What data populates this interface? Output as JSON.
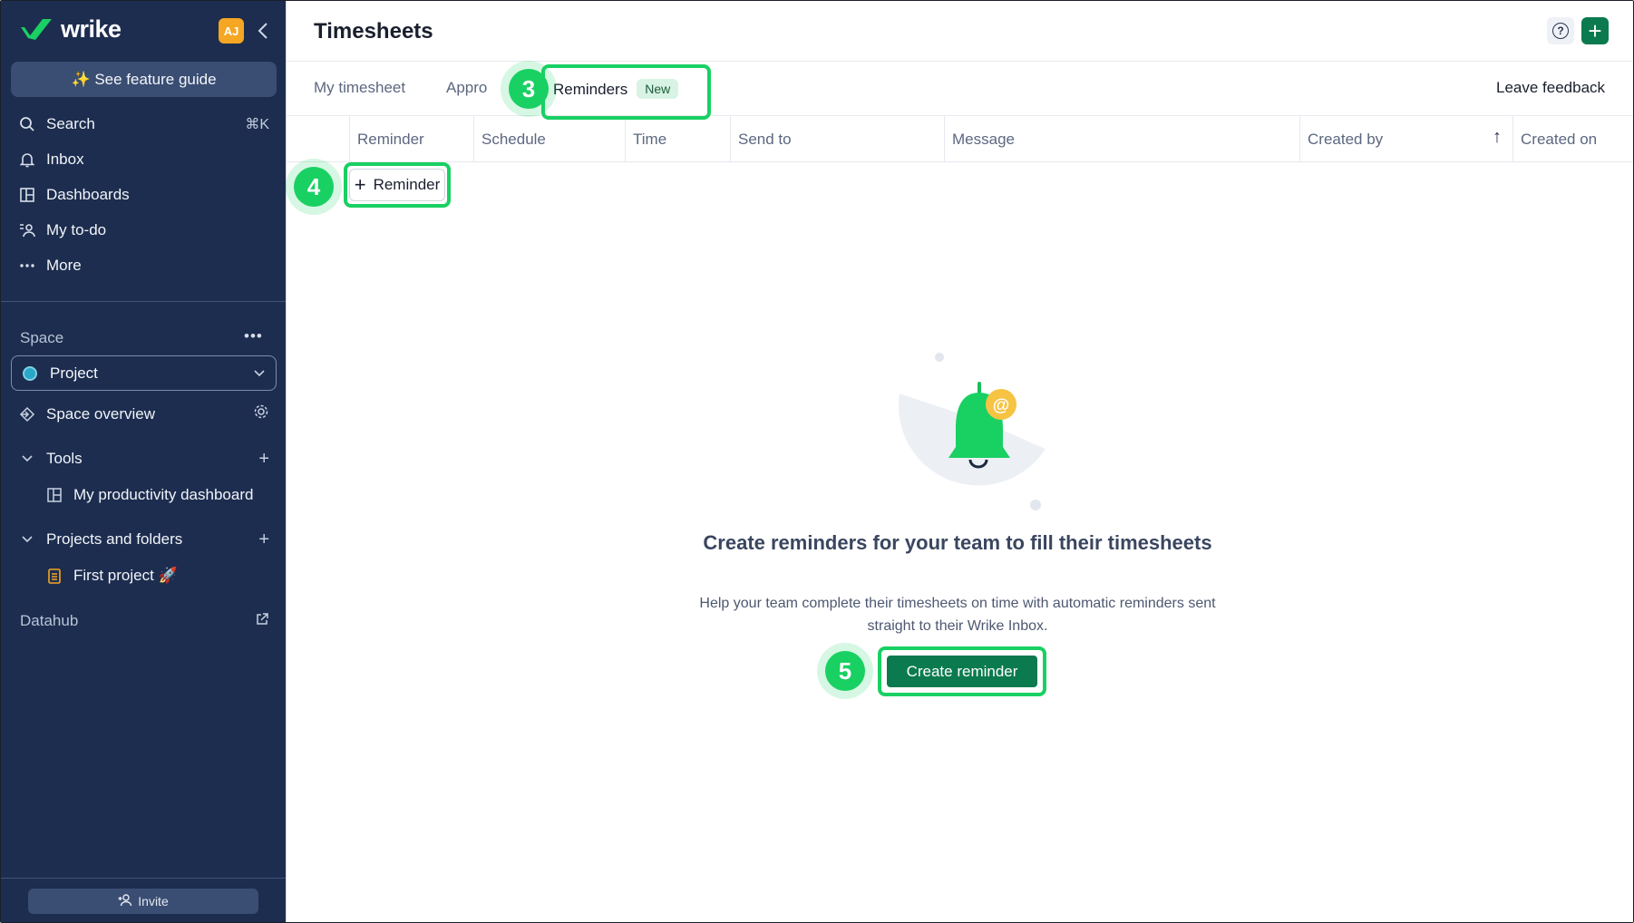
{
  "app": {
    "logo_text": "wrike",
    "avatar_initials": "AJ"
  },
  "sidebar": {
    "feature_guide_label": "✨ See feature guide",
    "nav": [
      {
        "label": "Search",
        "shortcut": "⌘K",
        "icon": "search-icon"
      },
      {
        "label": "Inbox",
        "icon": "bell-icon"
      },
      {
        "label": "Dashboards",
        "icon": "dashboard-icon"
      },
      {
        "label": "My to-do",
        "icon": "todo-icon"
      },
      {
        "label": "More",
        "icon": "more-icon"
      }
    ],
    "space_label": "Space",
    "space_more": "•••",
    "project_select_value": "Project",
    "space_overview_label": "Space overview",
    "tools_label": "Tools",
    "tools_children": [
      {
        "label": "My productivity dashboard"
      }
    ],
    "projects_label": "Projects and folders",
    "projects_children": [
      {
        "label": "First project 🚀"
      }
    ],
    "datahub_label": "Datahub",
    "invite_label": "Invite"
  },
  "header": {
    "title": "Timesheets"
  },
  "tabs": [
    {
      "label": "My timesheet"
    },
    {
      "label": "Appro"
    },
    {
      "label": "Reminders",
      "badge": "New"
    }
  ],
  "leave_feedback": "Leave feedback",
  "table": {
    "columns": [
      "Reminder",
      "Schedule",
      "Time",
      "Send to",
      "Message",
      "Created by",
      "Created on"
    ],
    "sort_indicator": "↑"
  },
  "add_reminder_label": "Reminder",
  "empty_state": {
    "title": "Create reminders for your team to fill their timesheets",
    "description": "Help your team complete their timesheets on time with automatic reminders sent straight to their Wrike Inbox.",
    "button_label": "Create reminder"
  },
  "annotations": {
    "step3": "3",
    "step4": "4",
    "step5": "5"
  },
  "colors": {
    "sidebar_bg": "#1d2d4f",
    "accent_green": "#0b7a4f",
    "highlight_green": "#19d063"
  }
}
